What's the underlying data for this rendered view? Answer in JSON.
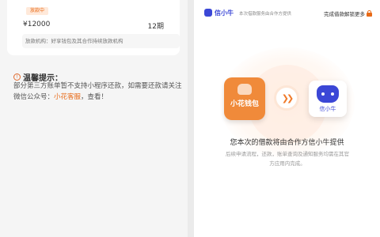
{
  "left_panel": {
    "loan": {
      "status": "放款中",
      "amount": "¥12000",
      "term": "12期",
      "lender": "放款机构：好享钱包及其合作持续放款机构"
    },
    "tips": {
      "title": "温馨提示：",
      "body_prefix": "部分第三方账单暂不支持小程序还款，如需要还款请关注微信公众号：",
      "highlight": "小花客服",
      "body_suffix": "，查看！"
    }
  },
  "right_panel": {
    "brand": {
      "name": "信小牛",
      "note": "本次借款服务由合作方提供"
    },
    "topbar_action": "完成借款解锁更多",
    "app_left_label": "小花钱包",
    "app_right_label": "信小牛",
    "notice_title": "您本次的借款将由合作方信小牛提供",
    "notice_sub": "后续申请流程，还款，账单查询及通知服务均需在其官方应用内完成。"
  },
  "colors": {
    "accent_orange": "#e86a17",
    "brand_blue": "#3b47d6"
  }
}
